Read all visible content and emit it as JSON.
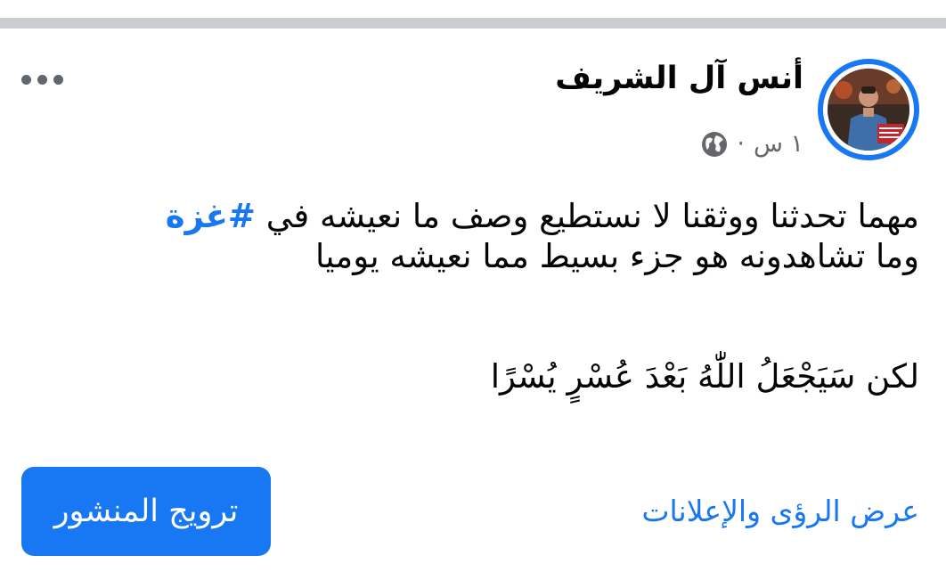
{
  "post": {
    "author_name": "أنس آل الشريف",
    "time_ago": "١ س",
    "meta_separator": "·",
    "privacy_icon": "globe-icon",
    "more_icon": "more-horizontal-icon",
    "text": {
      "line1_prefix": "مهما تحدثنا ووثقنا لا نستطيع وصف ما نعيشه في",
      "hashtag": "#غزة",
      "line2": "وما تشاهدونه هو جزء بسيط مما نعيشه يوميا",
      "line3": "لكن سَيَجْعَلُ اللّٰهُ بَعْدَ عُسْرٍ يُسْرًا"
    }
  },
  "actions": {
    "insights_label": "عرض الرؤى والإعلانات",
    "boost_label": "ترويج المنشور"
  },
  "colors": {
    "accent": "#1877f2",
    "text": "#050505",
    "secondary_text": "#65676b",
    "divider": "#c9ccd1"
  }
}
